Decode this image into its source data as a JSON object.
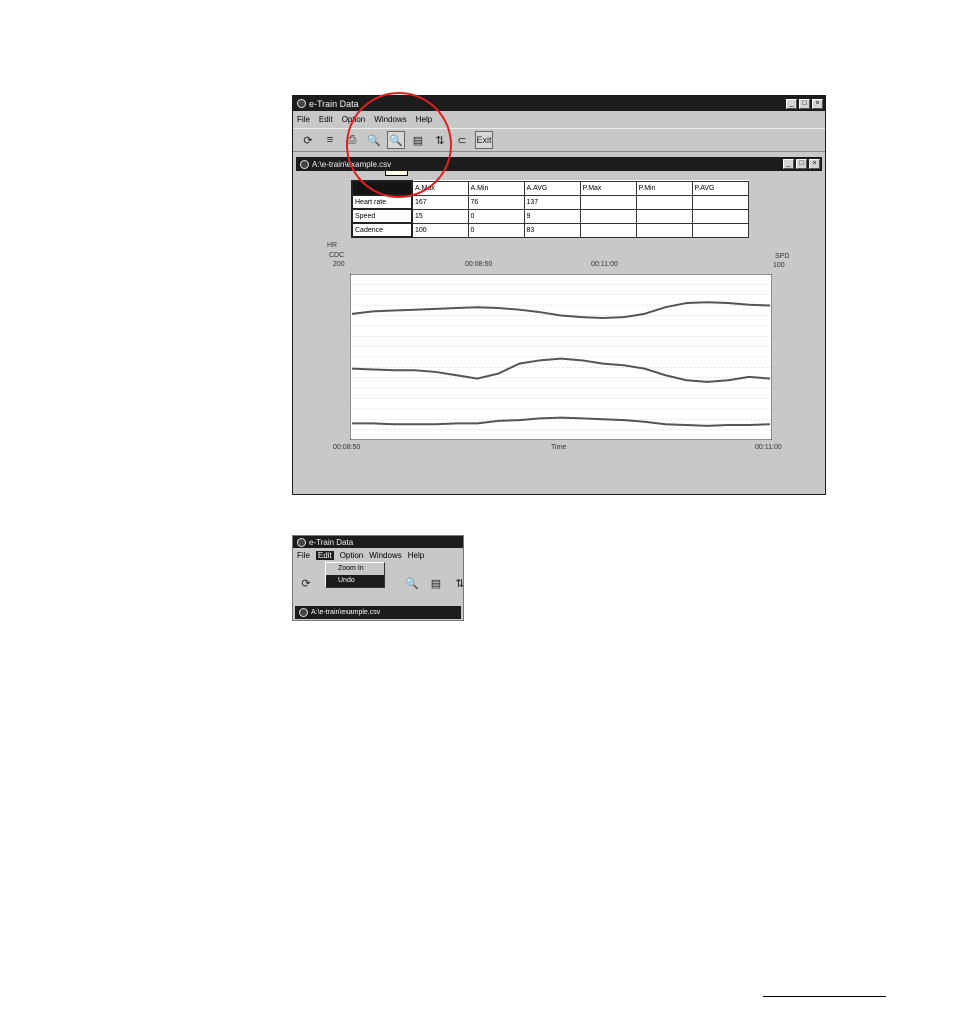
{
  "app": {
    "title": "e-Train Data",
    "window_buttons": [
      "_",
      "□",
      "×"
    ]
  },
  "menu": [
    "File",
    "Edit",
    "Option",
    "Windows",
    "Help"
  ],
  "toolbar": {
    "btn1": "⟳",
    "btn2": "≡",
    "btn3": "⎙",
    "btn4": "🔍",
    "btn5": "🔍",
    "btn6": "▤",
    "btn7": "⇅",
    "btn8": "⊂",
    "exit_label": "Exit",
    "tooltip": "Undo"
  },
  "document": {
    "title": "A:\\e-train\\example.csv",
    "window_buttons": [
      "_",
      "□",
      "×"
    ]
  },
  "table": {
    "headers": [
      "A.Max",
      "A.Min",
      "A.AVG",
      "P.Max",
      "P.Min",
      "P.AVG"
    ],
    "rows": [
      {
        "label": "Heart rate",
        "cells": [
          "167",
          "76",
          "137",
          "",
          "",
          ""
        ]
      },
      {
        "label": "Speed",
        "cells": [
          "15",
          "0",
          "9",
          "",
          "",
          ""
        ]
      },
      {
        "label": "Cadence",
        "cells": [
          "100",
          "0",
          "83",
          "",
          "",
          ""
        ]
      }
    ]
  },
  "chart_axes": {
    "left_top": "HR",
    "left_mid": "CDC",
    "left_max": "200",
    "right_top": "SPD",
    "right_max": "100",
    "top_time_1": "00:08:50",
    "top_time_2": "00:11:00",
    "bottom_start": "00:08:50",
    "bottom_mid": "Time",
    "bottom_end": "00:11:00"
  },
  "chart_data": {
    "type": "line",
    "xlabel": "Time",
    "x": [
      0,
      1,
      2,
      3,
      4,
      5,
      6,
      7,
      8,
      9,
      10,
      11,
      12,
      13,
      14,
      15,
      16,
      17,
      18,
      19,
      20
    ],
    "ylim": [
      0,
      200
    ],
    "grid": true,
    "series": [
      {
        "values": [
          152,
          155,
          156,
          157,
          158,
          159,
          160,
          159,
          157,
          154,
          150,
          148,
          147,
          148,
          152,
          160,
          165,
          166,
          165,
          163,
          162
        ]
      },
      {
        "values": [
          86,
          85,
          84,
          84,
          82,
          78,
          74,
          80,
          92,
          96,
          98,
          96,
          92,
          90,
          86,
          78,
          72,
          70,
          72,
          76,
          74
        ]
      },
      {
        "values": [
          20,
          20,
          19,
          19,
          19,
          20,
          20,
          23,
          24,
          26,
          27,
          26,
          25,
          24,
          22,
          19,
          18,
          17,
          18,
          18,
          19
        ]
      }
    ],
    "colors": [
      "#555555",
      "#555555",
      "#555555"
    ]
  },
  "inset": {
    "title": "e-Train Data",
    "menu": [
      "File",
      "Edit",
      "Option",
      "Windows",
      "Help"
    ],
    "dropdown": [
      "Zoom In",
      "Undo"
    ],
    "doc_title": "A:\\e-train\\example.csv",
    "toolbar": [
      "⟳",
      "🔍",
      "▤",
      "⇅"
    ]
  }
}
